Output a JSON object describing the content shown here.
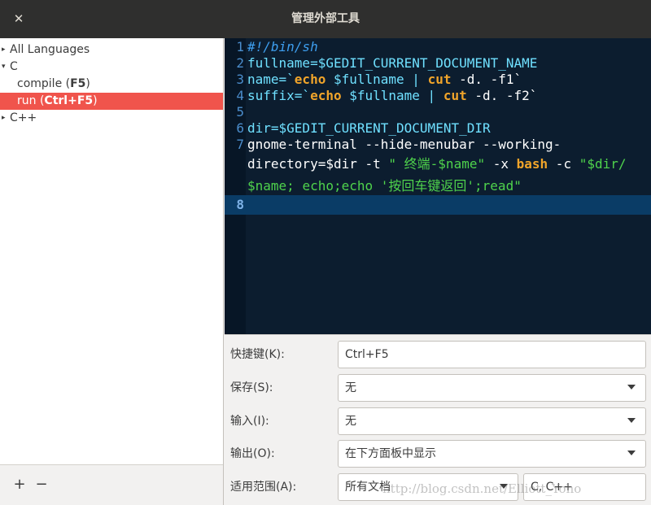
{
  "window": {
    "title": "管理外部工具",
    "close_glyph": "✕"
  },
  "tree": {
    "items": [
      {
        "label": "All Languages",
        "arrow": "▸"
      },
      {
        "label": "C",
        "arrow": "▾"
      },
      {
        "label_prefix": "compile (",
        "shortcut": "F5",
        "label_suffix": ")"
      },
      {
        "label_prefix": "run (",
        "shortcut": "Ctrl+F5",
        "label_suffix": ")"
      },
      {
        "label": "C++",
        "arrow": "▸"
      }
    ]
  },
  "footer": {
    "add_label": "+",
    "remove_label": "−"
  },
  "editor": {
    "line_numbers": [
      "1",
      "2",
      "3",
      "4",
      "5",
      "6",
      "7",
      "8"
    ],
    "lines": {
      "l1": "#!/bin/sh",
      "l2a": "fullname=",
      "l2b": "$GEDIT_CURRENT_DOCUMENT_NAME",
      "l3a": "name=`",
      "l3b": "echo",
      "l3c": " $fullname | ",
      "l3d": "cut",
      "l3e": " -d. -f1`",
      "l4a": "suffix=`",
      "l4b": "echo",
      "l4c": " $fullname | ",
      "l4d": "cut",
      "l4e": " -d. -f2`",
      "l6a": "dir=",
      "l6b": "$GEDIT_CURRENT_DOCUMENT_DIR",
      "l7a": "gnome-terminal --hide-menubar --working-",
      "l7b": "directory=$dir -t ",
      "l7c": "\" 终端-",
      "l7d": "$name",
      "l7e": "\"",
      "l7f": " -x ",
      "l7g": "bash",
      "l7h": " -c ",
      "l7i": "\"",
      "l7j": "$dir/",
      "l7k": "$name",
      "l7l": "; echo;echo '按回车键返回';read\""
    }
  },
  "form": {
    "shortcut": {
      "label": "快捷键(K):",
      "value": "Ctrl+F5"
    },
    "save": {
      "label": "保存(S):",
      "value": "无"
    },
    "input": {
      "label": "输入(I):",
      "value": "无"
    },
    "output": {
      "label": "输出(O):",
      "value": "在下方面板中显示"
    },
    "applicability": {
      "label": "适用范围(A):",
      "value": "所有文档",
      "languages": "C, C++"
    }
  },
  "watermark": "http://blog.csdn.net/Elliott_Yoho"
}
